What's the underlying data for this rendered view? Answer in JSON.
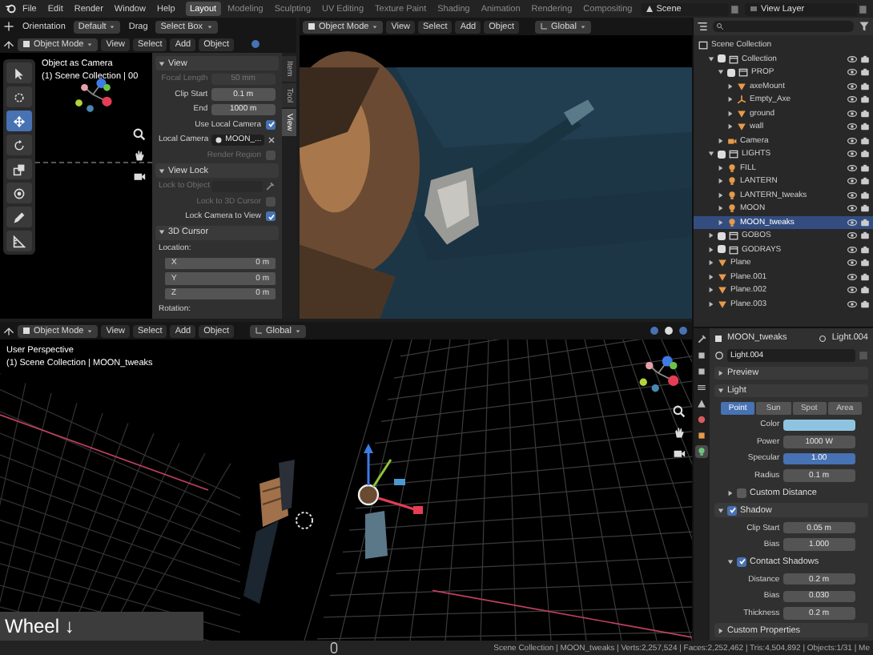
{
  "menu_bar": {
    "menus": [
      "File",
      "Edit",
      "Render",
      "Window",
      "Help"
    ],
    "workspaces": [
      {
        "label": "Layout",
        "selected": true
      },
      {
        "label": "Modeling",
        "selected": false
      },
      {
        "label": "Sculpting",
        "selected": false
      },
      {
        "label": "UV Editing",
        "selected": false
      },
      {
        "label": "Texture Paint",
        "selected": false
      },
      {
        "label": "Shading",
        "selected": false
      },
      {
        "label": "Animation",
        "selected": false
      },
      {
        "label": "Rendering",
        "selected": false
      },
      {
        "label": "Compositing",
        "selected": false
      }
    ],
    "scene": "Scene",
    "view_layer": "View Layer"
  },
  "tool_header": {
    "orientation": "Orientation",
    "pivot": "Default",
    "drag_label": "Drag",
    "drag": "Select Box"
  },
  "top_left_viewport": {
    "header": {
      "mode": "Object Mode",
      "menus": [
        "View",
        "Select",
        "Add",
        "Object"
      ]
    },
    "overlay": [
      "Object as Camera",
      "(1) Scene Collection | 00"
    ],
    "tools": [
      {
        "kind": "select",
        "selected": false
      },
      {
        "kind": "cursor",
        "selected": false
      },
      {
        "kind": "move",
        "selected": true
      },
      {
        "kind": "rotate",
        "selected": false
      },
      {
        "kind": "scale",
        "selected": false
      },
      {
        "kind": "transform",
        "selected": false
      },
      {
        "kind": "annotate",
        "selected": false
      },
      {
        "kind": "measure",
        "selected": false
      }
    ],
    "sidebar": {
      "tabs": [
        {
          "label": "Item",
          "selected": false
        },
        {
          "label": "Tool",
          "selected": false
        },
        {
          "label": "View",
          "selected": true
        }
      ],
      "panels": [
        {
          "title": "View",
          "expanded": true,
          "rows": [
            {
              "kind": "field",
              "label": "Focal Length",
              "value": "50 mm",
              "disabled": true
            },
            {
              "kind": "field",
              "label": "Clip Start",
              "value": "0.1 m",
              "disabled": false
            },
            {
              "kind": "field",
              "label": "End",
              "value": "1000 m",
              "disabled": false
            },
            {
              "kind": "check",
              "label": "Use Local Camera",
              "checked": true,
              "disabled": false
            },
            {
              "kind": "object",
              "label": "Local Camera",
              "value": "MOON_...",
              "disabled": false
            },
            {
              "kind": "check",
              "label": "Render Region",
              "checked": false,
              "disabled": true
            }
          ]
        },
        {
          "title": "View Lock",
          "expanded": true,
          "rows": [
            {
              "kind": "object",
              "label": "Lock to Object",
              "disabled": true
            },
            {
              "kind": "check",
              "label": "Lock to 3D Cursor",
              "checked": false,
              "disabled": true
            },
            {
              "kind": "check",
              "label": "Lock Camera to View",
              "checked": true,
              "disabled": false
            }
          ]
        },
        {
          "title": "3D Cursor",
          "expanded": true,
          "rows": [
            {
              "kind": "label",
              "label": "Location:"
            },
            {
              "kind": "vector",
              "label": "X",
              "value": "0 m"
            },
            {
              "kind": "vector",
              "label": "Y",
              "value": "0 m"
            },
            {
              "kind": "vector",
              "label": "Z",
              "value": "0 m"
            },
            {
              "kind": "label",
              "label": "Rotation:"
            }
          ]
        }
      ]
    }
  },
  "top_right_viewport": {
    "header": {
      "mode": "Object Mode",
      "menus": [
        "View",
        "Select",
        "Add",
        "Object"
      ],
      "orientation": "Global"
    }
  },
  "bottom_viewport": {
    "header": {
      "mode": "Object Mode",
      "menus": [
        "View",
        "Select",
        "Add",
        "Object"
      ],
      "orientation": "Global"
    },
    "overlay": [
      "User Perspective",
      "(1) Scene Collection | MOON_tweaks"
    ],
    "key_overlay": "Wheel ↓"
  },
  "outliner": {
    "root": "Scene Collection",
    "items": [
      {
        "name": "Collection",
        "kind": "collection",
        "checked": true,
        "expanded": true,
        "selected": false,
        "children": [
          {
            "name": "PROP",
            "kind": "collection",
            "checked": true,
            "expanded": true,
            "selected": false,
            "children": [
              {
                "name": "axeMount",
                "kind": "mesh",
                "expanded": false,
                "selected": false
              },
              {
                "name": "Empty_Axe",
                "kind": "empty",
                "expanded": false,
                "selected": false
              },
              {
                "name": "ground",
                "kind": "mesh",
                "expanded": false,
                "selected": false
              },
              {
                "name": "wall",
                "kind": "mesh",
                "expanded": false,
                "selected": false
              }
            ]
          },
          {
            "name": "Camera",
            "kind": "camera",
            "expanded": false,
            "selected": false
          }
        ]
      },
      {
        "name": "LIGHTS",
        "kind": "collection",
        "checked": true,
        "expanded": true,
        "selected": false,
        "children": [
          {
            "name": "FILL",
            "kind": "light",
            "expanded": false,
            "selected": false
          },
          {
            "name": "LANTERN",
            "kind": "light",
            "expanded": false,
            "selected": false
          },
          {
            "name": "LANTERN_tweaks",
            "kind": "light",
            "expanded": false,
            "selected": false
          },
          {
            "name": "MOON",
            "kind": "light",
            "expanded": false,
            "selected": false
          },
          {
            "name": "MOON_tweaks",
            "kind": "light",
            "expanded": false,
            "selected": true
          }
        ]
      },
      {
        "name": "GOBOS",
        "kind": "collection",
        "checked": true,
        "expanded": false,
        "selected": false
      },
      {
        "name": "GODRAYS",
        "kind": "collection",
        "checked": true,
        "expanded": false,
        "selected": false
      },
      {
        "name": "Plane",
        "kind": "mesh",
        "expanded": false,
        "selected": false
      },
      {
        "name": "Plane.001",
        "kind": "mesh",
        "expanded": false,
        "selected": false
      },
      {
        "name": "Plane.002",
        "kind": "mesh",
        "expanded": false,
        "selected": false
      },
      {
        "name": "Plane.003",
        "kind": "mesh",
        "expanded": false,
        "selected": false
      }
    ]
  },
  "properties": {
    "object": "MOON_tweaks",
    "data": "Light.004",
    "datablock": "Light.004",
    "tabs": [
      {
        "kind": "tool",
        "selected": false
      },
      {
        "kind": "render",
        "selected": false
      },
      {
        "kind": "output",
        "selected": false
      },
      {
        "kind": "view_layer",
        "selected": false
      },
      {
        "kind": "scene",
        "selected": false
      },
      {
        "kind": "world",
        "selected": false
      },
      {
        "kind": "object",
        "selected": false
      },
      {
        "kind": "data",
        "selected": true
      }
    ],
    "rows": [
      {
        "kind": "panel",
        "label": "Preview",
        "expanded": false
      },
      {
        "kind": "panel",
        "label": "Light",
        "expanded": true
      },
      {
        "kind": "tabs",
        "tabs": [
          {
            "label": "Point",
            "selected": true
          },
          {
            "label": "Sun",
            "selected": false
          },
          {
            "label": "Spot",
            "selected": false
          },
          {
            "label": "Area",
            "selected": false
          }
        ]
      },
      {
        "kind": "color",
        "label": "Color",
        "color": "#8ec4e0"
      },
      {
        "kind": "field",
        "label": "Power",
        "value": "1000 W"
      },
      {
        "kind": "slider",
        "label": "Specular",
        "value": "1.00",
        "level": 1
      },
      {
        "kind": "field",
        "label": "Radius",
        "value": "0.1 m"
      },
      {
        "kind": "subpanel",
        "label": "Custom Distance",
        "expanded": false,
        "checked": false
      },
      {
        "kind": "panel",
        "label": "Shadow",
        "expanded": true,
        "checked": true
      },
      {
        "kind": "field",
        "label": "Clip Start",
        "value": "0.05 m"
      },
      {
        "kind": "field",
        "label": "Bias",
        "value": "1.000"
      },
      {
        "kind": "subpanel",
        "label": "Contact Shadows",
        "expanded": true,
        "checked": true
      },
      {
        "kind": "field",
        "label": "Distance",
        "value": "0.2 m"
      },
      {
        "kind": "field",
        "label": "Bias",
        "value": "0.030"
      },
      {
        "kind": "field",
        "label": "Thickness",
        "value": "0.2 m"
      },
      {
        "kind": "panel",
        "label": "Custom Properties",
        "expanded": false
      }
    ]
  },
  "status_bar": "Scene Collection | MOON_tweaks | Verts:2,257,524 | Faces:2,252,462 | Tris:4,504,892 | Objects:1/31 | Me"
}
